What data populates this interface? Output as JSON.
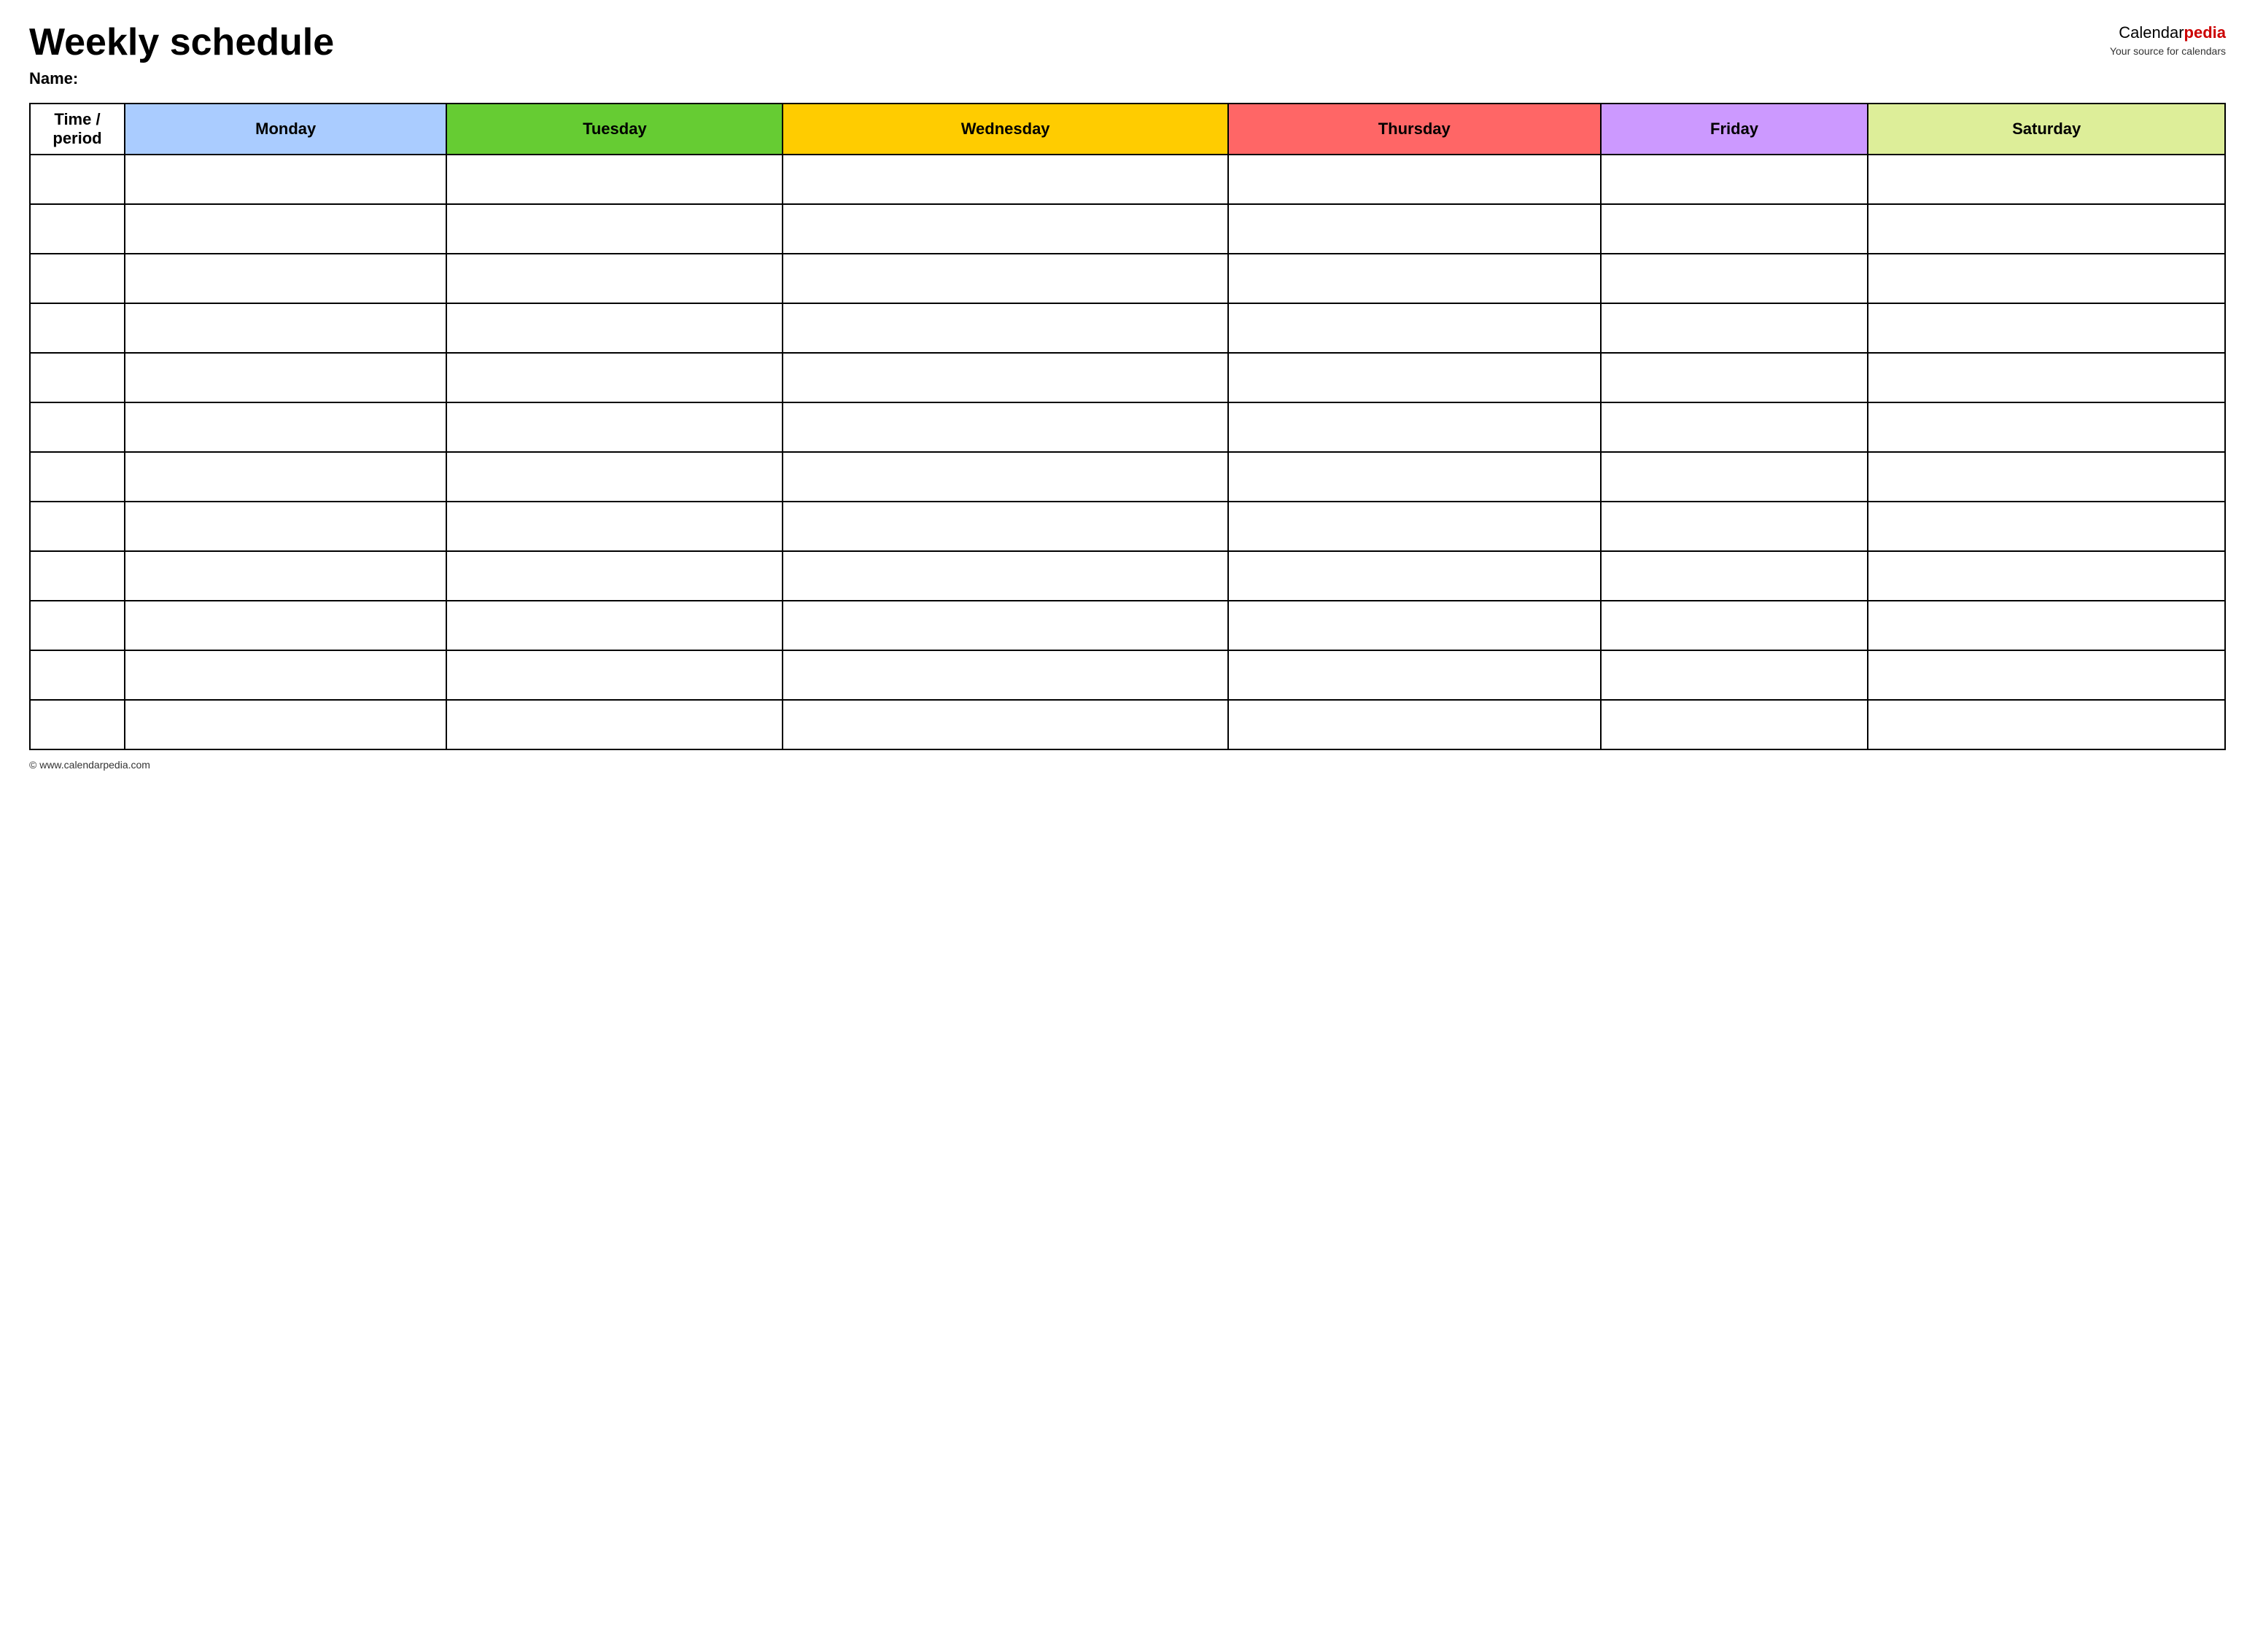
{
  "header": {
    "title": "Weekly schedule",
    "name_label": "Name:",
    "logo_text_calendar": "Calendar",
    "logo_text_pedia": "pedia",
    "logo_tagline": "Your source for calendars"
  },
  "table": {
    "headers": [
      {
        "label": "Time / period",
        "class": "time-header",
        "id": "time-period-header"
      },
      {
        "label": "Monday",
        "class": "monday-header",
        "id": "monday-header"
      },
      {
        "label": "Tuesday",
        "class": "tuesday-header",
        "id": "tuesday-header"
      },
      {
        "label": "Wednesday",
        "class": "wednesday-header",
        "id": "wednesday-header"
      },
      {
        "label": "Thursday",
        "class": "thursday-header",
        "id": "thursday-header"
      },
      {
        "label": "Friday",
        "class": "friday-header",
        "id": "friday-header"
      },
      {
        "label": "Saturday",
        "class": "saturday-header",
        "id": "saturday-header"
      }
    ],
    "row_count": 12
  },
  "footer": {
    "url": "© www.calendarpedia.com"
  }
}
